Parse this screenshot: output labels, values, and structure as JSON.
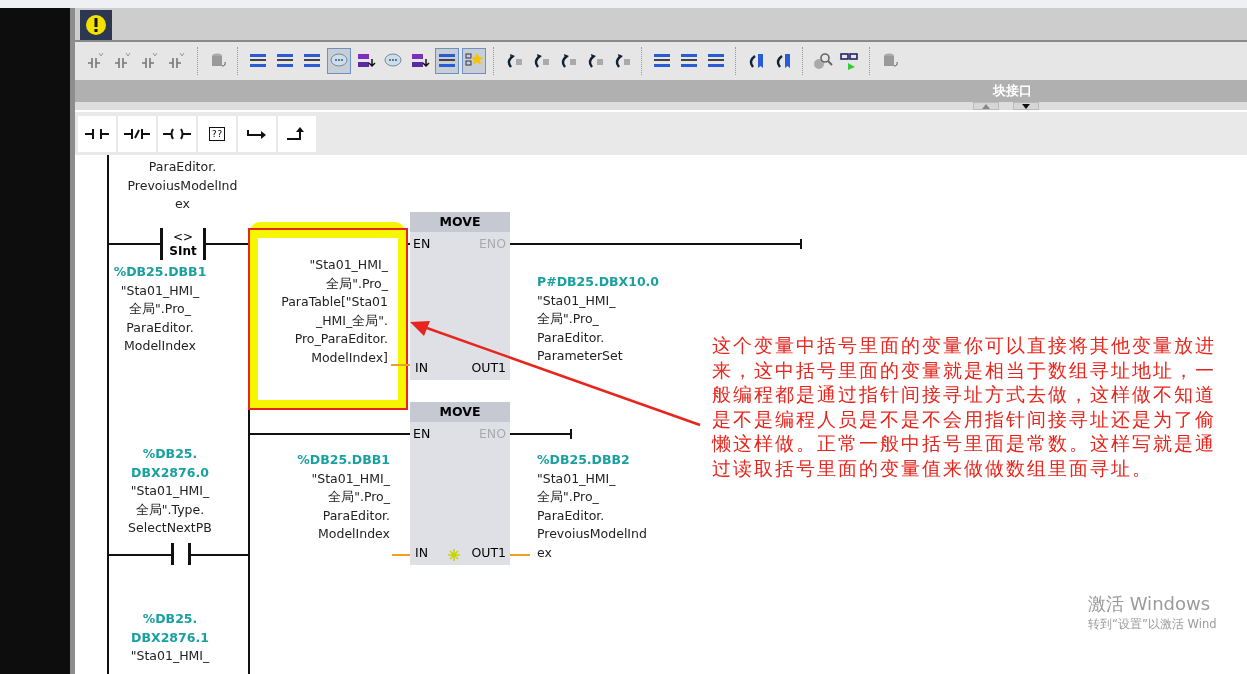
{
  "toolbar": [
    {
      "buttons": [
        {
          "on": false
        },
        {
          "on": false
        },
        {
          "on": false
        },
        {
          "on": false
        }
      ]
    },
    {
      "buttons": [
        {
          "on": false
        }
      ]
    },
    {
      "buttons": [
        {
          "on": false
        },
        {
          "on": false
        },
        {
          "on": false
        },
        {
          "on": true
        },
        {
          "on": false
        },
        {
          "on": false
        },
        {
          "on": false
        },
        {
          "on": true
        },
        {
          "on": true
        }
      ]
    },
    {
      "buttons": [
        {
          "on": false
        },
        {
          "on": false
        },
        {
          "on": false
        },
        {
          "on": false
        },
        {
          "on": false
        }
      ]
    },
    {
      "buttons": [
        {
          "on": false
        },
        {
          "on": false
        },
        {
          "on": false
        }
      ]
    },
    {
      "buttons": [
        {
          "on": false
        },
        {
          "on": false
        }
      ]
    },
    {
      "buttons": [
        {
          "on": false
        },
        {
          "on": false
        }
      ]
    },
    {
      "buttons": [
        {
          "on": false
        }
      ]
    }
  ],
  "interface_bar": {
    "title": "块接口"
  },
  "lad_elements": [
    {
      "kind": "no-contact"
    },
    {
      "kind": "nc-contact"
    },
    {
      "kind": "coil"
    },
    {
      "kind": "empty-box",
      "label": "??"
    },
    {
      "kind": "open-branch"
    },
    {
      "kind": "close-branch"
    }
  ],
  "diagram": {
    "top_operand": {
      "tag": [
        "ParaEditor.",
        "PrevoiusModelInd",
        "ex"
      ]
    },
    "contact_1": {
      "symbol": "<>",
      "type": "SInt",
      "address": [
        "%DB25.DBB1"
      ],
      "tag": [
        "\"Sta01_HMI_",
        "全局\".Pro_",
        "ParaEditor.",
        "ModelIndex"
      ]
    },
    "move_1": {
      "title": "MOVE",
      "en": "EN",
      "eno": "ENO",
      "in": "IN",
      "out": "OUT1",
      "in_operand": {
        "tag": [
          "\"Sta01_HMI_",
          "全局\".Pro_",
          "ParaTable[\"Sta01",
          "_HMI_全局\".",
          "Pro_ParaEditor.",
          "ModelIndex]"
        ]
      },
      "out_operand": {
        "address": [
          "P#DB25.DBX10.0"
        ],
        "tag": [
          "\"Sta01_HMI_",
          "全局\".Pro_",
          "ParaEditor.",
          "ParameterSet"
        ]
      }
    },
    "contact_2": {
      "address": [
        "%DB25.",
        "DBX2876.0"
      ],
      "tag": [
        "\"Sta01_HMI_",
        "全局\".Type.",
        "SelectNextPB"
      ]
    },
    "move_2": {
      "title": "MOVE",
      "en": "EN",
      "eno": "ENO",
      "in": "IN",
      "out": "OUT1",
      "in_operand": {
        "address": [
          "%DB25.DBB1"
        ],
        "tag": [
          "\"Sta01_HMI_",
          "全局\".Pro_",
          "ParaEditor.",
          "ModelIndex"
        ]
      },
      "out_operand": {
        "address": [
          "%DB25.DBB2"
        ],
        "tag": [
          "\"Sta01_HMI_",
          "全局\".Pro_",
          "ParaEditor.",
          "PrevoiusModelInd",
          "ex"
        ]
      }
    },
    "contact_3": {
      "address": [
        "%DB25.",
        "DBX2876.1"
      ],
      "tag": [
        "\"Sta01_HMI_"
      ]
    }
  },
  "annotation": {
    "text": "这个变量中括号里面的变量你可以直接将其他变量放进来，这中括号里面的变量就是相当于数组寻址地址，一般编程都是通过指针间接寻址方式去做，这样做不知道是不是编程人员是不是不会用指针间接寻址还是为了偷懒这样做。正常一般中括号里面是常数。这样写就是通过读取括号里面的变量值来做做数组里面寻址。"
  },
  "os_notice": {
    "title": "激活 Windows",
    "hint": "转到“设置”以激活 Wind"
  }
}
